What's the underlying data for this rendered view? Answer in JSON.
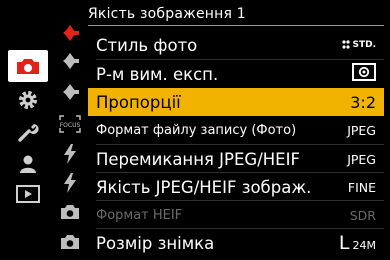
{
  "menu": {
    "title": "Якість зображення 1",
    "page_number": "1"
  },
  "categories": [
    {
      "name": "camera-icon",
      "active": true
    },
    {
      "name": "gear-icon",
      "active": false
    },
    {
      "name": "wrench-icon",
      "active": false
    },
    {
      "name": "person-icon",
      "active": false
    },
    {
      "name": "playback-icon",
      "active": false
    }
  ],
  "subtabs": [
    "diamond-arrow-icon-1",
    "diamond-arrow-icon-2",
    "diamond-arrow-icon-3",
    "focus-icon",
    "flash-icon",
    "flash-icon",
    "camera-small-icon",
    "camera-small-icon"
  ],
  "items": [
    {
      "label": "Стиль фото",
      "value": "STD."
    },
    {
      "label": "Р-м вим. експ.",
      "value": "metering-icon"
    },
    {
      "label": "Пропорції",
      "value": "3:2"
    },
    {
      "label": "Формат файлу запису (Фото)",
      "value": "JPEG"
    },
    {
      "label": "Перемикання JPEG/HEIF",
      "value": "JPEG"
    },
    {
      "label": "Якість JPEG/HEIF зображ.",
      "value": "FINE"
    },
    {
      "label": "Формат HEIF",
      "value": "SDR"
    },
    {
      "label": "Розмір знімка",
      "value_letter": "L",
      "value_size": "24M"
    }
  ],
  "colors": {
    "selection": "#f2b300",
    "camera_tab": "#e2231a",
    "disabled_text": "#6b6b6b"
  }
}
